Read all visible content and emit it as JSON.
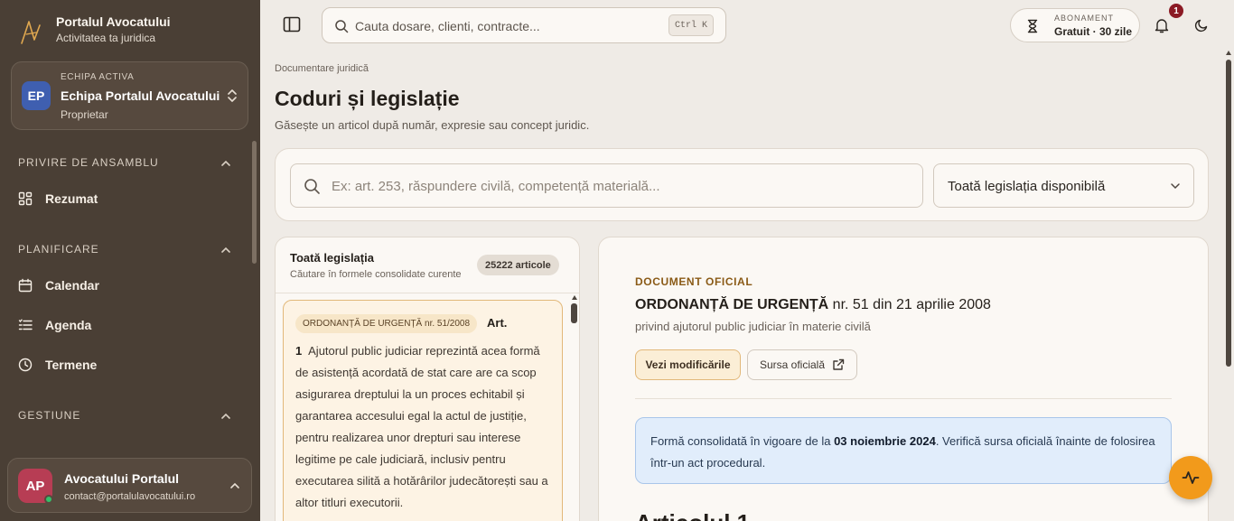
{
  "brand": {
    "title": "Portalul Avocatului",
    "subtitle": "Activitatea ta juridica"
  },
  "team": {
    "kicker": "ECHIPA ACTIVA",
    "initials": "EP",
    "name": "Echipa Portalul Avocatului",
    "role": "Proprietar",
    "avatar_color": "#3f5fb0"
  },
  "sidebar": {
    "sections": [
      {
        "title": "PRIVIRE DE ANSAMBLU",
        "items": [
          {
            "label": "Rezumat",
            "icon": "grid-icon"
          }
        ]
      },
      {
        "title": "PLANIFICARE",
        "items": [
          {
            "label": "Calendar",
            "icon": "calendar-icon"
          },
          {
            "label": "Agenda",
            "icon": "list-icon"
          },
          {
            "label": "Termene",
            "icon": "clock-icon"
          }
        ]
      },
      {
        "title": "GESTIUNE",
        "items": []
      }
    ]
  },
  "user": {
    "initials": "AP",
    "name": "Avocatului Portalul",
    "email": "contact@portalulavocatului.ro",
    "avatar_color": "#b73d54",
    "status_color": "#34c06a"
  },
  "topbar": {
    "search_placeholder": "Cauta dosare, clienti, contracte...",
    "shortcut": "Ctrl K",
    "subscription_kicker": "ABONAMENT",
    "subscription_value": "Gratuit · 30 zile",
    "notifications_count": "1"
  },
  "page": {
    "breadcrumb": "Documentare juridică",
    "title": "Coduri și legislație",
    "subtitle": "Găsește un articol după număr, expresie sau concept juridic.",
    "search_placeholder": "Ex: art. 253, răspundere civilă, competență materială...",
    "scope_value": "Toată legislația disponibilă"
  },
  "list": {
    "title": "Toată legislația",
    "subtitle": "Căutare în formele consolidate curente",
    "count": "25222 articole",
    "result": {
      "act": "ORDONANȚĂ DE URGENȚĂ nr. 51/2008",
      "article_label": "Art.",
      "article_number": "1",
      "text": "Ajutorul public judiciar reprezintă acea formă de asistență acordată de stat care are ca scop asigurarea dreptului la un proces echitabil și garantarea accesului egal la actul de justiție, pentru realizarea unor drepturi sau interese legitime pe cale judiciară, inclusiv pentru executarea silită a hotărârilor judecătorești sau a altor titluri executorii."
    }
  },
  "document": {
    "kicker": "DOCUMENT OFICIAL",
    "act_type": "ORDONANȚĂ DE URGENȚĂ",
    "act_ref": "nr. 51 din 21 aprilie 2008",
    "subtitle": "privind ajutorul public judiciar în materie civilă",
    "btn_modifications": "Vezi modificările",
    "btn_source": "Sursa oficială",
    "info_prefix": "Formă consolidată în vigoare de la",
    "info_date": "03 noiembrie 2024",
    "info_suffix": ". Verifică sursa oficială înainte de folosirea într-un act procedural.",
    "article_heading": "Articolul 1"
  },
  "colors": {
    "accent": "#f29a1b",
    "sidebar_bg": "#4a3f35",
    "kicker": "#8a5a16",
    "info_bg": "#e1edfb"
  }
}
